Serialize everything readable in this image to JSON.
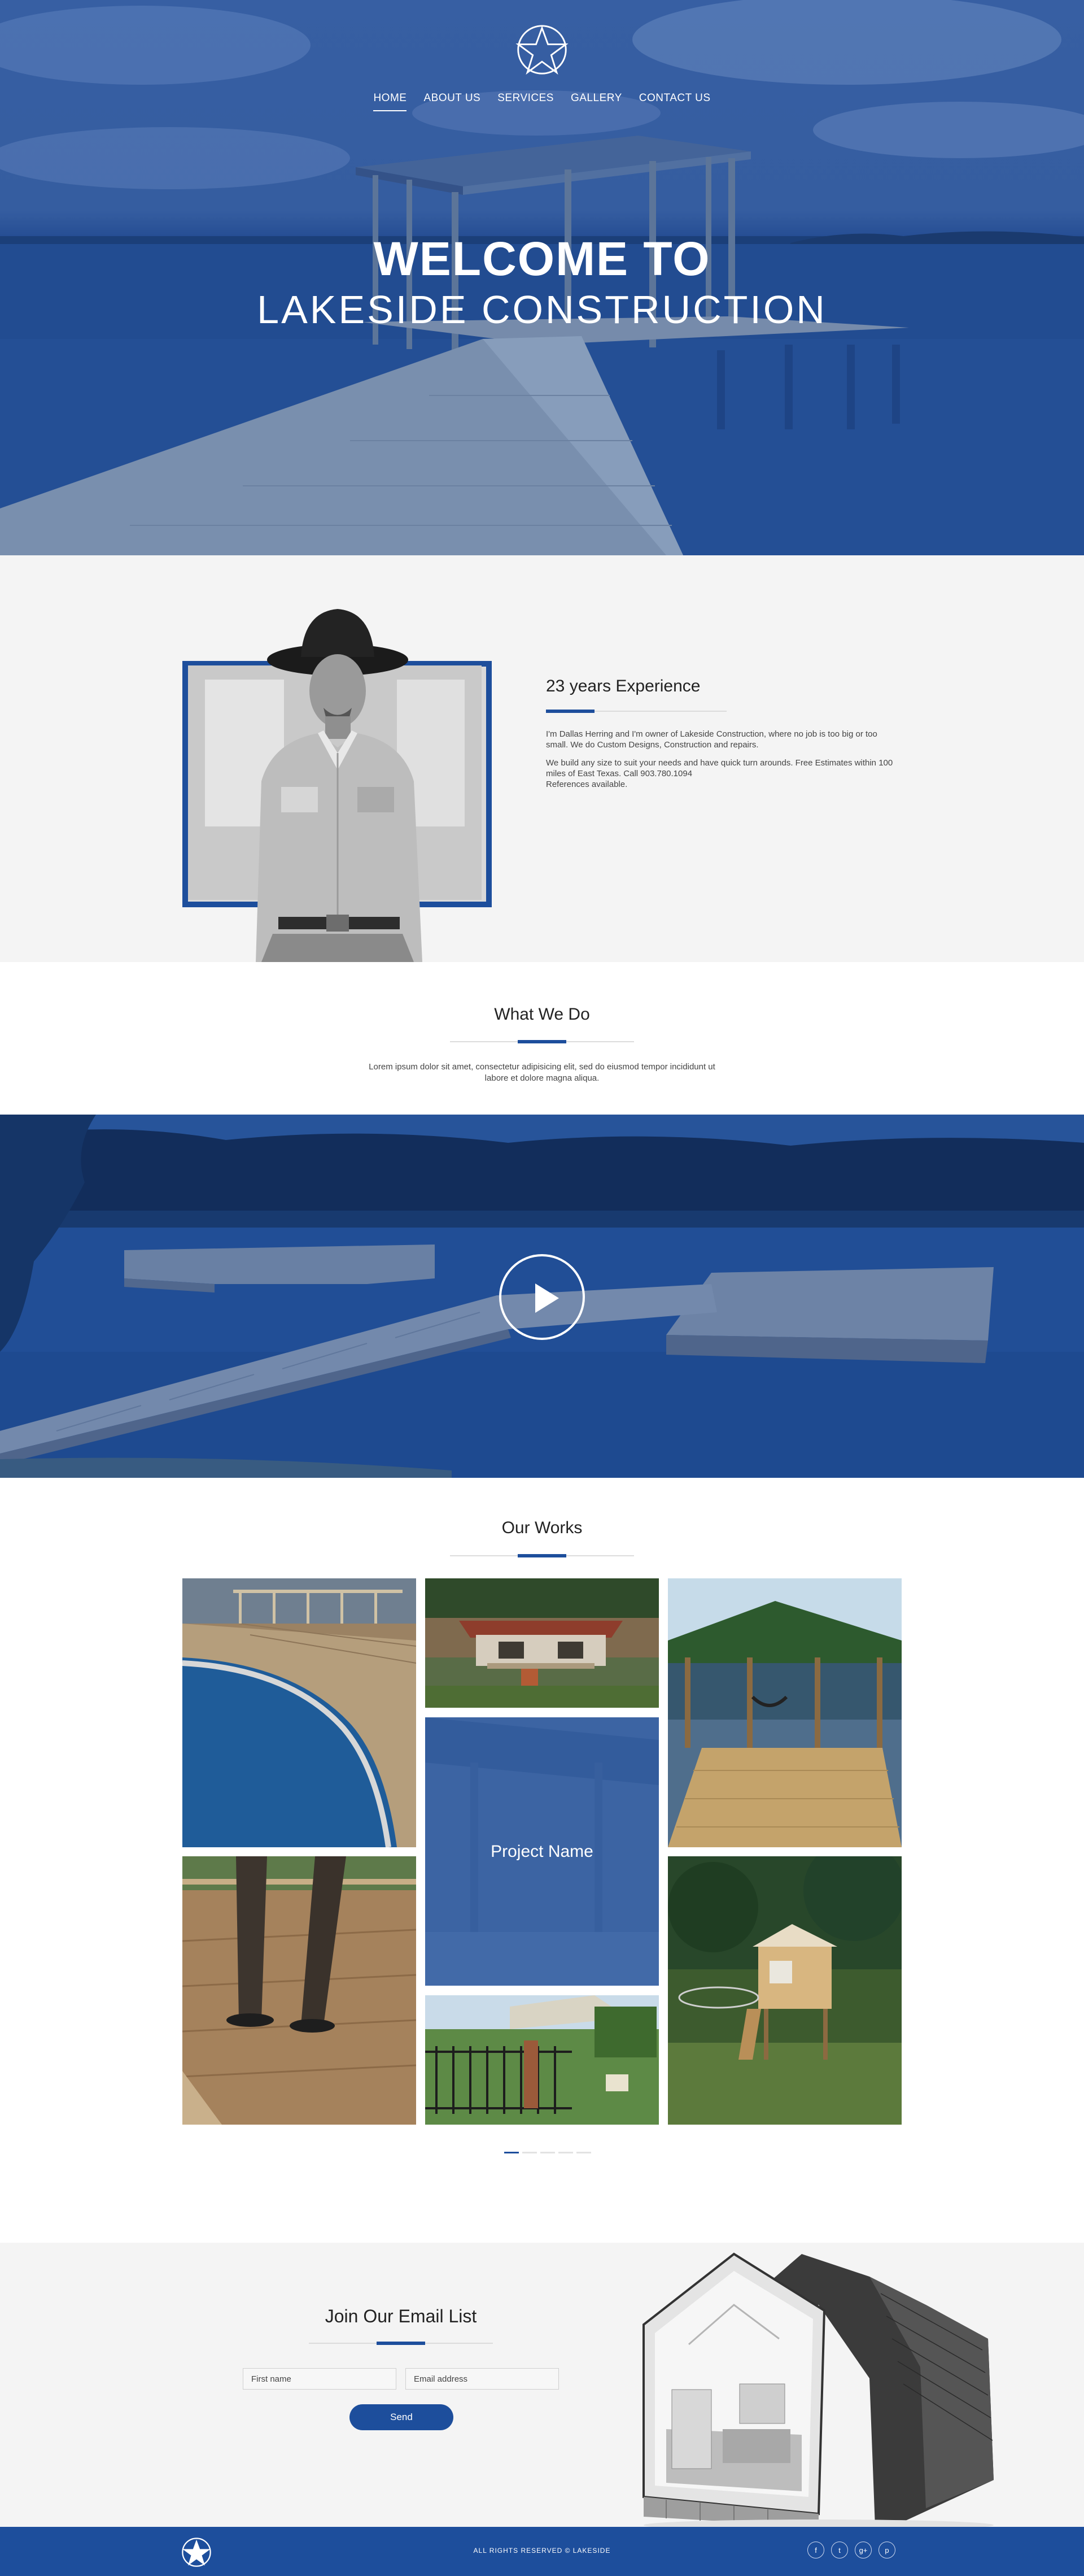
{
  "nav": {
    "items": [
      {
        "label": "HOME",
        "active": true
      },
      {
        "label": "ABOUT US",
        "active": false
      },
      {
        "label": "SERVICES",
        "active": false
      },
      {
        "label": "GALLERY",
        "active": false
      },
      {
        "label": "CONTACT US",
        "active": false
      }
    ]
  },
  "hero": {
    "title": "WELCOME TO",
    "subtitle": "LAKESIDE CONSTRUCTION"
  },
  "about": {
    "heading": "23 years Experience",
    "paragraph1": "I'm Dallas Herring and I'm owner of Lakeside Construction, where no job is too big or too small. We do Custom Designs, Construction and repairs.",
    "paragraph2": "We build any size to suit your needs and have quick turn arounds. Free Estimates within 100 miles of East Texas. Call 903.780.1094",
    "paragraph3": "References available."
  },
  "whatwedo": {
    "title": "What We Do",
    "text": "Lorem ipsum dolor sit amet, consectetur adipisicing elit, sed do eiusmod tempor incididunt ut labore et dolore magna aliqua."
  },
  "video": {
    "play_icon": "play-icon"
  },
  "works": {
    "title": "Our Works",
    "hover_label": "Project Name",
    "pager": [
      true,
      false,
      false,
      false,
      false
    ]
  },
  "email": {
    "title": "Join Our Email List",
    "first_name_placeholder": "First name",
    "email_placeholder": "Email address",
    "send_label": "Send"
  },
  "footer": {
    "copyright": "ALL RIGHTS RESERVED © LAKESIDE",
    "socials": [
      {
        "icon": "facebook-icon",
        "glyph": "f"
      },
      {
        "icon": "twitter-icon",
        "glyph": "t"
      },
      {
        "icon": "google-plus-icon",
        "glyph": "g+"
      },
      {
        "icon": "pinterest-icon",
        "glyph": "p"
      }
    ]
  },
  "colors": {
    "brand_blue": "#1d4e9c",
    "section_gray": "#f4f4f4"
  }
}
